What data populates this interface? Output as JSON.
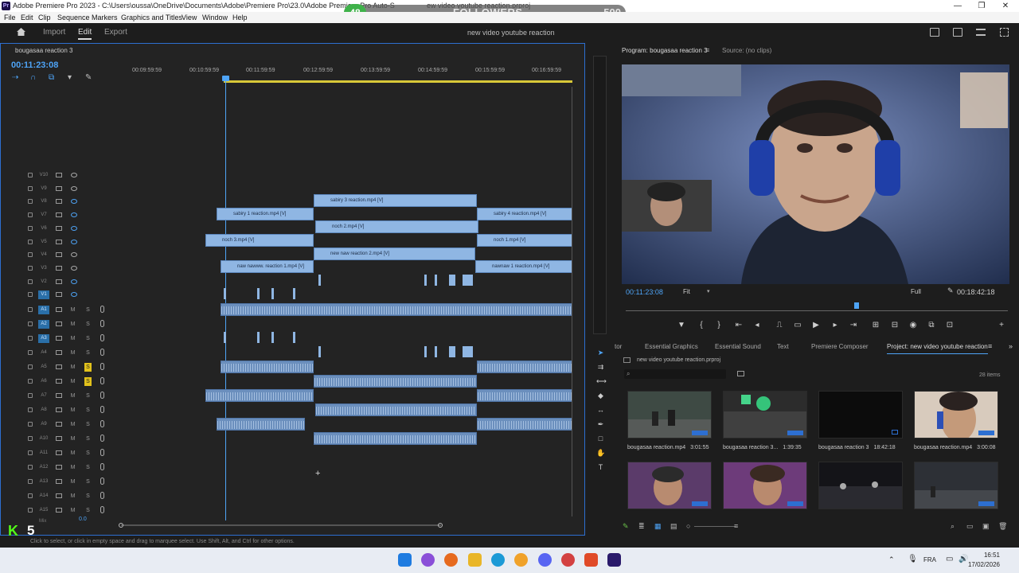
{
  "window": {
    "title": "Adobe Premiere Pro 2023 - C:\\Users\\oussa\\OneDrive\\Documents\\Adobe\\Premiere Pro\\23.0\\Adobe Premiere Pro Auto-S",
    "title_tail": "ew video youtube reaction.prproj",
    "minimize": "—",
    "maximize": "❐",
    "close": "✕"
  },
  "overlay": {
    "followers_count": "48",
    "followers_label": "FOLLOWERS",
    "followers_goal": "500",
    "kick_number": "5"
  },
  "menu": [
    "File",
    "Edit",
    "Clip",
    "Sequence",
    "Markers",
    "Graphics and Titles",
    "View",
    "Window",
    "Help"
  ],
  "workspace": {
    "home_icon": "home-icon",
    "tabs": [
      "Import",
      "Edit",
      "Export"
    ],
    "active": "Edit",
    "project_name": "new video youtube reaction"
  },
  "timeline": {
    "sequence_tab": "bougasaa reaction 3",
    "timecode": "00:11:23:08",
    "ruler": [
      "00:09:59:59",
      "00:10:59:59",
      "00:11:59:59",
      "00:12:59:59",
      "00:13:59:59",
      "00:14:59:59",
      "00:15:59:59",
      "00:16:59:59"
    ],
    "video_tracks": [
      "V10",
      "V9",
      "V8",
      "V7",
      "V6",
      "V5",
      "V4",
      "V3",
      "V2",
      "V1"
    ],
    "audio_tracks": [
      "A1",
      "A2",
      "A3",
      "A4",
      "A5",
      "A6",
      "A7",
      "A8",
      "A9",
      "A10",
      "A11",
      "A12",
      "A13",
      "A14",
      "A15"
    ],
    "mix_label": "Mix",
    "mix_value": "0.0",
    "clips": {
      "v8": "sabiry 3 reaction.mp4 [V]",
      "v7a": "sabiry 1 reaction.mp4 [V]",
      "v7b": "sabiry 4 reaction.mp4 [V]",
      "v6": "noch 2.mp4 [V]",
      "v5a": "noch 3.mp4 [V]",
      "v5b": "noch 1.mp4 [V]",
      "v4": "new naw reaction 2.mp4 [V]",
      "v3a": "naw nawww. reaction 1.mp4 [V]",
      "v3b": "nawnaw 1 reaction.mp4 [V]"
    }
  },
  "program": {
    "tab": "Program: bougasaa reaction 3",
    "source_tab": "Source: (no clips)",
    "timecode": "00:11:23:08",
    "fit": "Fit",
    "resolution": "Full",
    "duration": "00:18:42:18"
  },
  "project": {
    "tabs": [
      "tor",
      "Essential Graphics",
      "Essential Sound",
      "Text",
      "Premiere Composer",
      "Project: new video youtube reaction"
    ],
    "file": "new video youtube reaction.prproj",
    "item_count": "28 items",
    "items": [
      {
        "name": "bougasaa reaction.mp4",
        "duration": "3:01:55"
      },
      {
        "name": "bougasaa reaction 3...",
        "duration": "1:39:35"
      },
      {
        "name": "bougasaa reaction 3",
        "duration": "18:42:18"
      },
      {
        "name": "bougasaa reaction.mp4",
        "duration": "3:00:08"
      }
    ]
  },
  "status_text": "Click to select, or click in empty space and drag to marquee select. Use Shift, Alt, and Ctrl for other options.",
  "taskbar": {
    "language": "FRA",
    "time": "16:51",
    "date": "17/02/2026"
  }
}
